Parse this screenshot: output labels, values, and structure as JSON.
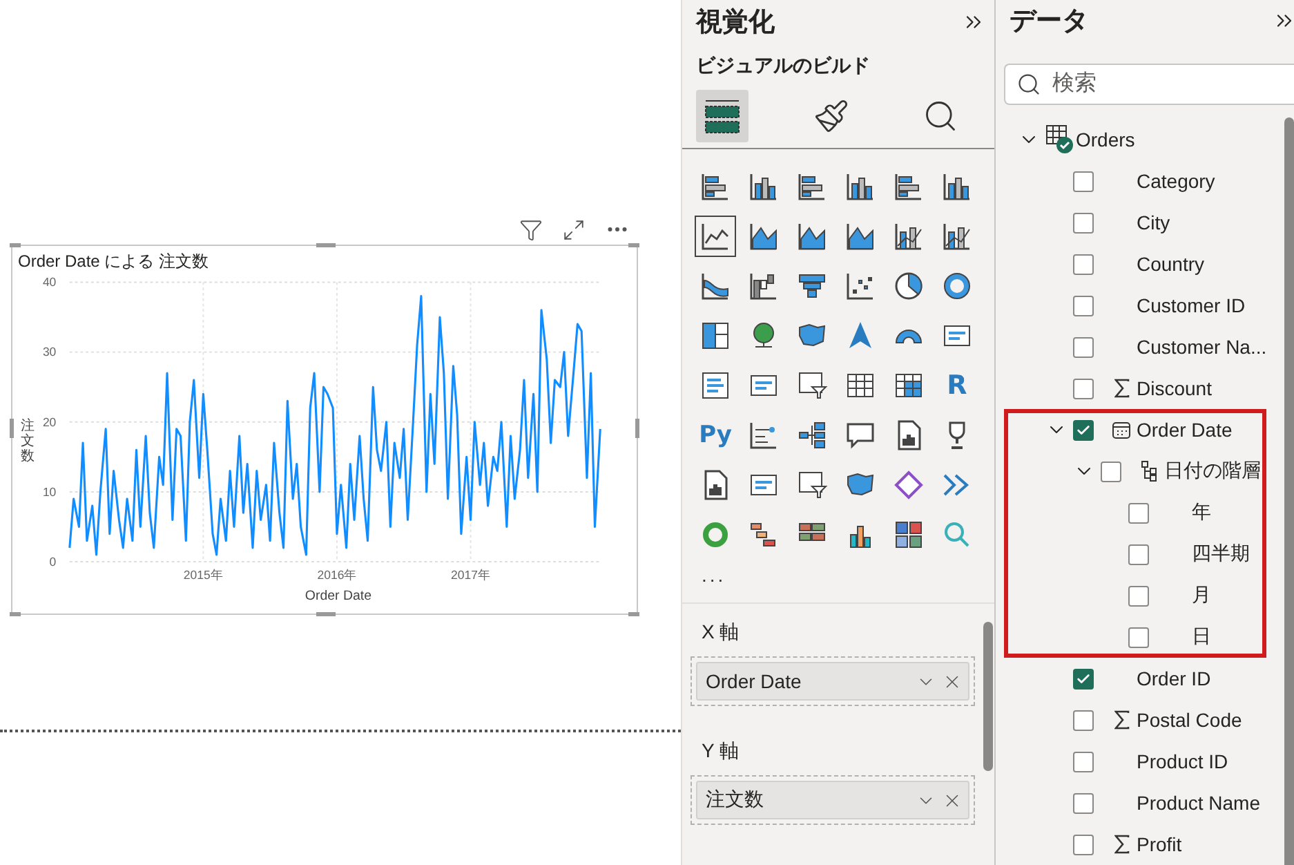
{
  "visual": {
    "chart_data": {
      "type": "line",
      "title": "Order Date による 注文数",
      "xlabel": "Order Date",
      "ylabel": "注文数",
      "grid": true,
      "xlim": [
        2014,
        2017.97
      ],
      "ylim": [
        0,
        40
      ],
      "x": [
        2014,
        2014.03,
        2014.07,
        2014.1,
        2014.13,
        2014.17,
        2014.2,
        2014.23,
        2014.27,
        2014.3,
        2014.33,
        2014.37,
        2014.4,
        2014.43,
        2014.47,
        2014.5,
        2014.53,
        2014.57,
        2014.6,
        2014.63,
        2014.67,
        2014.7,
        2014.73,
        2014.77,
        2014.8,
        2014.83,
        2014.87,
        2014.9,
        2014.93,
        2014.97,
        2015,
        2015.03,
        2015.07,
        2015.1,
        2015.13,
        2015.17,
        2015.2,
        2015.23,
        2015.27,
        2015.3,
        2015.33,
        2015.37,
        2015.4,
        2015.43,
        2015.47,
        2015.5,
        2015.53,
        2015.57,
        2015.6,
        2015.63,
        2015.67,
        2015.7,
        2015.73,
        2015.77,
        2015.8,
        2015.83,
        2015.87,
        2015.9,
        2015.93,
        2015.97,
        2016,
        2016.03,
        2016.07,
        2016.1,
        2016.13,
        2016.17,
        2016.2,
        2016.23,
        2016.27,
        2016.3,
        2016.33,
        2016.37,
        2016.4,
        2016.43,
        2016.47,
        2016.5,
        2016.53,
        2016.57,
        2016.6,
        2016.63,
        2016.67,
        2016.7,
        2016.73,
        2016.77,
        2016.8,
        2016.83,
        2016.87,
        2016.9,
        2016.93,
        2016.97,
        2017,
        2017.03,
        2017.07,
        2017.1,
        2017.13,
        2017.17,
        2017.2,
        2017.23,
        2017.27,
        2017.3,
        2017.33,
        2017.37,
        2017.4,
        2017.43,
        2017.47,
        2017.5,
        2017.53,
        2017.57,
        2017.6,
        2017.63,
        2017.67,
        2017.7,
        2017.73,
        2017.77,
        2017.8,
        2017.83,
        2017.87,
        2017.9,
        2017.93,
        2017.97
      ],
      "xticks": [
        {
          "value": 2015,
          "label": "2015年"
        },
        {
          "value": 2016,
          "label": "2016年"
        },
        {
          "value": 2017,
          "label": "2017年"
        }
      ],
      "yticks": [
        0,
        10,
        20,
        30,
        40
      ],
      "series": [
        {
          "color": "#118dff",
          "values": [
            2,
            9,
            5,
            17,
            3,
            8,
            1,
            10,
            19,
            4,
            13,
            6,
            2,
            9,
            3,
            16,
            5,
            18,
            7,
            2,
            15,
            11,
            27,
            6,
            19,
            18,
            3,
            20,
            26,
            12,
            24,
            16,
            4,
            1,
            9,
            3,
            13,
            5,
            18,
            7,
            14,
            2,
            13,
            6,
            11,
            3,
            17,
            7,
            2,
            23,
            9,
            14,
            5,
            1,
            22,
            27,
            10,
            25,
            24,
            22,
            4,
            11,
            2,
            14,
            6,
            18,
            9,
            3,
            25,
            16,
            13,
            20,
            5,
            17,
            12,
            19,
            6,
            20,
            31,
            38,
            10,
            24,
            14,
            35,
            27,
            9,
            28,
            21,
            4,
            15,
            6,
            20,
            11,
            17,
            8,
            15,
            13,
            20,
            5,
            18,
            9,
            16,
            26,
            12,
            24,
            10,
            36,
            29,
            17,
            26,
            25,
            30,
            18,
            27,
            34,
            33,
            12,
            27,
            5,
            19
          ]
        }
      ]
    }
  },
  "visualizations": {
    "title": "視覚化",
    "subtitle": "ビジュアルのビルド",
    "build_tabs": [
      {
        "selected": true
      },
      {
        "selected": false
      },
      {
        "selected": false
      }
    ],
    "visuals": [
      {
        "kind": "icon",
        "selected": false
      },
      {
        "kind": "icon",
        "selected": false
      },
      {
        "kind": "icon",
        "selected": false
      },
      {
        "kind": "icon",
        "selected": false
      },
      {
        "kind": "icon",
        "selected": false
      },
      {
        "kind": "icon",
        "selected": false
      },
      {
        "kind": "icon",
        "selected": true
      },
      {
        "kind": "icon",
        "selected": false
      },
      {
        "kind": "icon",
        "selected": false
      },
      {
        "kind": "icon",
        "selected": false
      },
      {
        "kind": "icon",
        "selected": false
      },
      {
        "kind": "icon",
        "selected": false
      },
      {
        "kind": "icon",
        "selected": false
      },
      {
        "kind": "icon",
        "selected": false
      },
      {
        "kind": "icon",
        "selected": false
      },
      {
        "kind": "icon",
        "selected": false
      },
      {
        "kind": "icon",
        "selected": false
      },
      {
        "kind": "icon",
        "selected": false
      },
      {
        "kind": "icon",
        "selected": false
      },
      {
        "kind": "icon",
        "selected": false
      },
      {
        "kind": "icon",
        "selected": false
      },
      {
        "kind": "icon",
        "selected": false
      },
      {
        "kind": "icon",
        "selected": false
      },
      {
        "kind": "icon",
        "selected": false
      },
      {
        "kind": "icon",
        "selected": false
      },
      {
        "kind": "icon",
        "selected": false
      },
      {
        "kind": "icon",
        "selected": false
      },
      {
        "kind": "icon",
        "selected": false
      },
      {
        "kind": "icon",
        "selected": false
      },
      {
        "kind": "text",
        "label": "R",
        "selected": false
      },
      {
        "kind": "text",
        "label": "Py",
        "selected": false
      },
      {
        "kind": "icon",
        "selected": false
      },
      {
        "kind": "icon",
        "selected": false
      },
      {
        "kind": "icon",
        "selected": false
      },
      {
        "kind": "icon",
        "selected": false
      },
      {
        "kind": "icon",
        "selected": false
      },
      {
        "kind": "icon",
        "selected": false
      },
      {
        "kind": "icon",
        "selected": false
      },
      {
        "kind": "icon",
        "selected": false
      },
      {
        "kind": "icon",
        "selected": false
      },
      {
        "kind": "icon",
        "selected": false
      },
      {
        "kind": "icon",
        "selected": false
      },
      {
        "kind": "icon",
        "selected": false
      },
      {
        "kind": "icon",
        "selected": false
      },
      {
        "kind": "icon",
        "selected": false
      },
      {
        "kind": "icon",
        "selected": false
      },
      {
        "kind": "icon",
        "selected": false
      },
      {
        "kind": "icon",
        "selected": false
      }
    ],
    "more": "...",
    "wells": [
      {
        "label": "X 軸",
        "field": "Order Date"
      },
      {
        "label": "Y 軸",
        "field": "注文数"
      }
    ]
  },
  "data": {
    "title": "データ",
    "search": {
      "placeholder": "検索"
    },
    "tree": [
      {
        "kind": "table",
        "label": "Orders",
        "expanded": true,
        "children": [
          {
            "kind": "field",
            "label": "Category",
            "checked": false,
            "highlighted": false
          },
          {
            "kind": "field",
            "label": "City",
            "checked": false,
            "highlighted": false
          },
          {
            "kind": "field",
            "label": "Country",
            "checked": false,
            "highlighted": false
          },
          {
            "kind": "field",
            "label": "Customer ID",
            "checked": false,
            "highlighted": false
          },
          {
            "kind": "field",
            "label": "Customer Na...",
            "checked": false,
            "highlighted": false
          },
          {
            "kind": "measure",
            "label": "Discount",
            "checked": false,
            "highlighted": false
          },
          {
            "kind": "date",
            "label": "Order Date",
            "checked": true,
            "expanded": true,
            "highlighted": true,
            "children": [
              {
                "kind": "hierarchy",
                "label": "日付の階層",
                "checked": false,
                "expanded": true,
                "children": [
                  {
                    "label": "年",
                    "checked": false
                  },
                  {
                    "label": "四半期",
                    "checked": false
                  },
                  {
                    "label": "月",
                    "checked": false
                  },
                  {
                    "label": "日",
                    "checked": false
                  }
                ]
              }
            ]
          },
          {
            "kind": "field",
            "label": "Order ID",
            "checked": true,
            "highlighted": false
          },
          {
            "kind": "measure",
            "label": "Postal Code",
            "checked": false,
            "highlighted": false
          },
          {
            "kind": "field",
            "label": "Product ID",
            "checked": false,
            "highlighted": false
          },
          {
            "kind": "field",
            "label": "Product Name",
            "checked": false,
            "highlighted": false
          },
          {
            "kind": "measure",
            "label": "Profit",
            "checked": false,
            "highlighted": false
          }
        ]
      }
    ]
  }
}
